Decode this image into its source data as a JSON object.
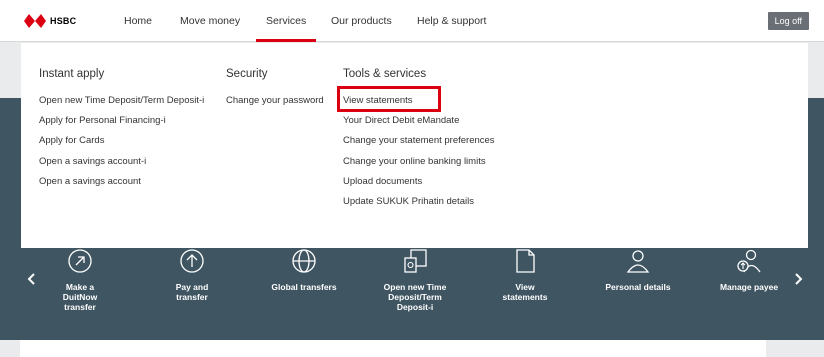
{
  "brand": {
    "name": "HSBC",
    "red": "#db0011",
    "dark": "#3f5562"
  },
  "nav": {
    "items": [
      {
        "label": "Home",
        "active": false
      },
      {
        "label": "Move money",
        "active": false
      },
      {
        "label": "Services",
        "active": true
      },
      {
        "label": "Our products",
        "active": false
      },
      {
        "label": "Help & support",
        "active": false
      }
    ],
    "logoff_label": "Log off"
  },
  "dropdown": {
    "columns": [
      {
        "title": "Instant apply",
        "links": [
          "Open new Time Deposit/Term Deposit-i",
          "Apply for Personal Financing-i",
          "Apply for Cards",
          "Open a savings account-i",
          "Open a savings account"
        ]
      },
      {
        "title": "Security",
        "links": [
          "Change your password"
        ]
      },
      {
        "title": "Tools & services",
        "links": [
          "View statements",
          "Your Direct Debit eMandate",
          "Change your statement preferences",
          "Change your online banking limits",
          "Upload documents",
          "Update SUKUK Prihatin details"
        ]
      }
    ],
    "highlighted": "View statements"
  },
  "quick_actions": [
    {
      "label": "Make a DuitNow transfer",
      "icon": "duitnow-arrow-icon"
    },
    {
      "label": "Pay and transfer",
      "icon": "upload-arrow-icon"
    },
    {
      "label": "Global transfers",
      "icon": "globe-icon"
    },
    {
      "label": "Open new Time Deposit/Term Deposit-i",
      "icon": "deposit-document-icon"
    },
    {
      "label": "View statements",
      "icon": "document-icon"
    },
    {
      "label": "Personal details",
      "icon": "person-icon"
    },
    {
      "label": "Manage payee",
      "icon": "payee-icon"
    }
  ],
  "carousel": {
    "prev_icon": "chevron-left-icon",
    "next_icon": "chevron-right-icon"
  }
}
